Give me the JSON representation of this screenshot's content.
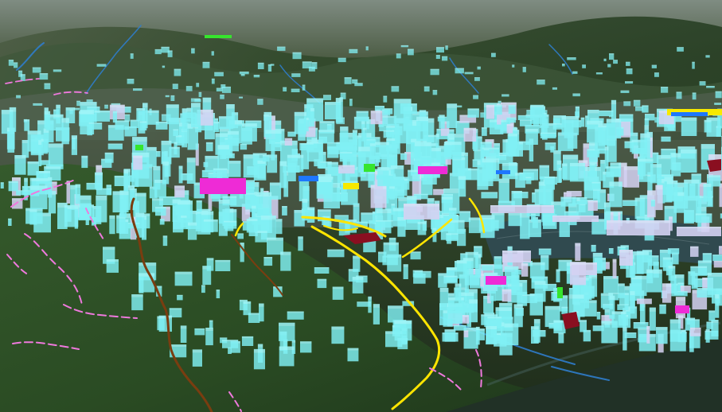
{
  "scene": {
    "type": "3d-aerial-map",
    "colors": {
      "sky_haze": "#6d7b72",
      "terrain_dark": "#243224",
      "terrain_mid": "#3f5a33",
      "terrain_light": "#6e7a56",
      "urban_ground": "#5a6460",
      "buildings_primary": "#80f0f4",
      "buildings_secondary": "#d4d2f2",
      "landmark_magenta": "#ee2bd6",
      "landmark_green": "#36e52d",
      "landmark_yellow": "#f7e900",
      "landmark_blue": "#1e77ff",
      "landmark_red": "#8a0f20",
      "road_yellow": "#ffe500",
      "trail_pink": "#ef79dd",
      "trail_brown": "#7a3d10",
      "water_blue": "#2f7dcc",
      "reservoir": "#304a4f"
    },
    "layers": [
      "terrain",
      "buildings",
      "roads",
      "trails",
      "rivers",
      "reservoir"
    ]
  }
}
